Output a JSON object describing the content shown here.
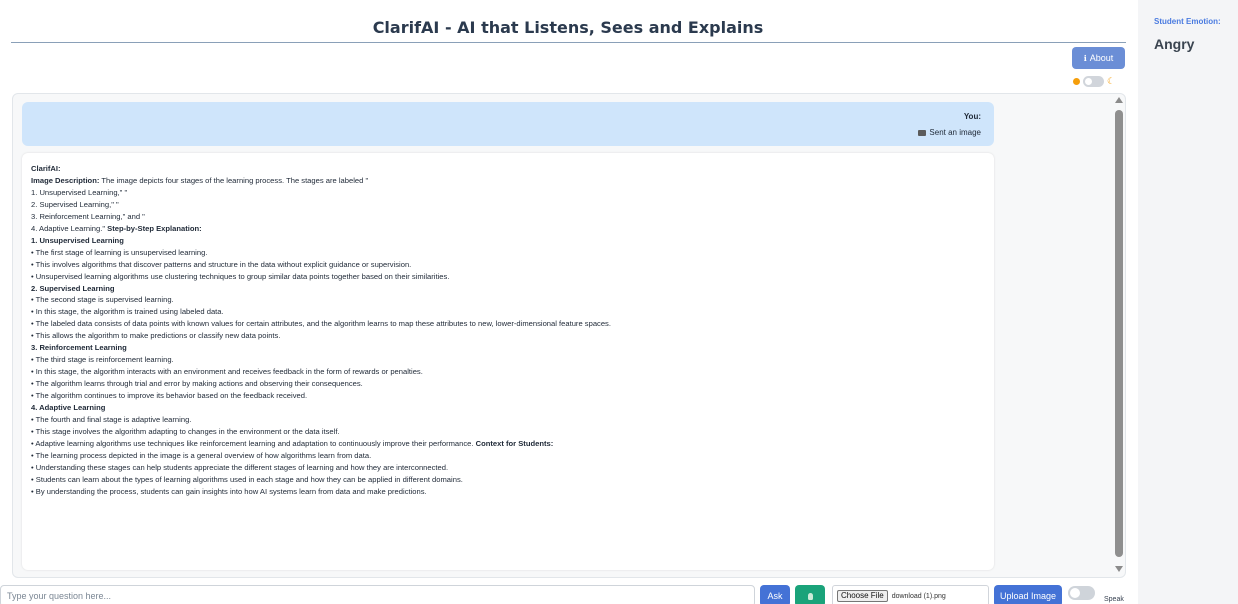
{
  "header": {
    "title": "ClarifAI - AI that Listens, Sees and Explains"
  },
  "about_button": {
    "icon": "info-icon",
    "label": "About"
  },
  "theme_toggle": {
    "state": "light"
  },
  "chat": {
    "user": {
      "label": "You:",
      "message": "Sent an image",
      "icon": "image-icon"
    },
    "bot": {
      "lines": [
        {
          "b": "ClarifAI:",
          "t": ""
        },
        {
          "b": "Image Description:",
          "t": " The image depicts four stages of the learning process. The stages are labeled \""
        },
        {
          "b": "",
          "t": "1. Unsupervised Learning,\" \""
        },
        {
          "b": "",
          "t": "2. Supervised Learning,\" \""
        },
        {
          "b": "",
          "t": "3. Reinforcement Learning,\" and \""
        },
        {
          "b": "",
          "t": "4. Adaptive Learning.\" ",
          "b2": "Step-by-Step Explanation:"
        },
        {
          "b": "1. Unsupervised Learning",
          "t": ""
        },
        {
          "b": "",
          "t": "• The first stage of learning is unsupervised learning."
        },
        {
          "b": "",
          "t": "• This involves algorithms that discover patterns and structure in the data without explicit guidance or supervision."
        },
        {
          "b": "",
          "t": "• Unsupervised learning algorithms use clustering techniques to group similar data points together based on their similarities."
        },
        {
          "b": "2. Supervised Learning",
          "t": ""
        },
        {
          "b": "",
          "t": "• The second stage is supervised learning."
        },
        {
          "b": "",
          "t": "• In this stage, the algorithm is trained using labeled data."
        },
        {
          "b": "",
          "t": "• The labeled data consists of data points with known values for certain attributes, and the algorithm learns to map these attributes to new, lower-dimensional feature spaces."
        },
        {
          "b": "",
          "t": "• This allows the algorithm to make predictions or classify new data points."
        },
        {
          "b": "3. Reinforcement Learning",
          "t": ""
        },
        {
          "b": "",
          "t": "• The third stage is reinforcement learning."
        },
        {
          "b": "",
          "t": "• In this stage, the algorithm interacts with an environment and receives feedback in the form of rewards or penalties."
        },
        {
          "b": "",
          "t": "• The algorithm learns through trial and error by making actions and observing their consequences."
        },
        {
          "b": "",
          "t": "• The algorithm continues to improve its behavior based on the feedback received."
        },
        {
          "b": "4. Adaptive Learning",
          "t": ""
        },
        {
          "b": "",
          "t": "• The fourth and final stage is adaptive learning."
        },
        {
          "b": "",
          "t": "• This stage involves the algorithm adapting to changes in the environment or the data itself."
        },
        {
          "b": "",
          "t": "• Adaptive learning algorithms use techniques like reinforcement learning and adaptation to continuously improve their performance. ",
          "b2": "Context for Students:"
        },
        {
          "b": "",
          "t": "• The learning process depicted in the image is a general overview of how algorithms learn from data."
        },
        {
          "b": "",
          "t": "• Understanding these stages can help students appreciate the different stages of learning and how they are interconnected."
        },
        {
          "b": "",
          "t": "• Students can learn about the types of learning algorithms used in each stage and how they can be applied in different domains."
        },
        {
          "b": "",
          "t": "• By understanding the process, students can gain insights into how AI systems learn from data and make predictions."
        }
      ]
    }
  },
  "input_bar": {
    "question_placeholder": "Type your question here...",
    "question_value": "",
    "ask_label": "Ask",
    "mic_icon": "microphone-icon",
    "choose_file_label": "Choose File",
    "file_name": "download (1).png",
    "upload_label": "Upload Image",
    "speak_label": "Speak",
    "speak_enabled": false
  },
  "sidebar": {
    "emotion_label": "Student Emotion:",
    "emotion_value": "Angry"
  },
  "colors": {
    "primary_button": "#4472d6",
    "mic_button": "#1aa37a",
    "user_bubble": "#cfe5fb",
    "emotion_label": "#4a7be0"
  }
}
